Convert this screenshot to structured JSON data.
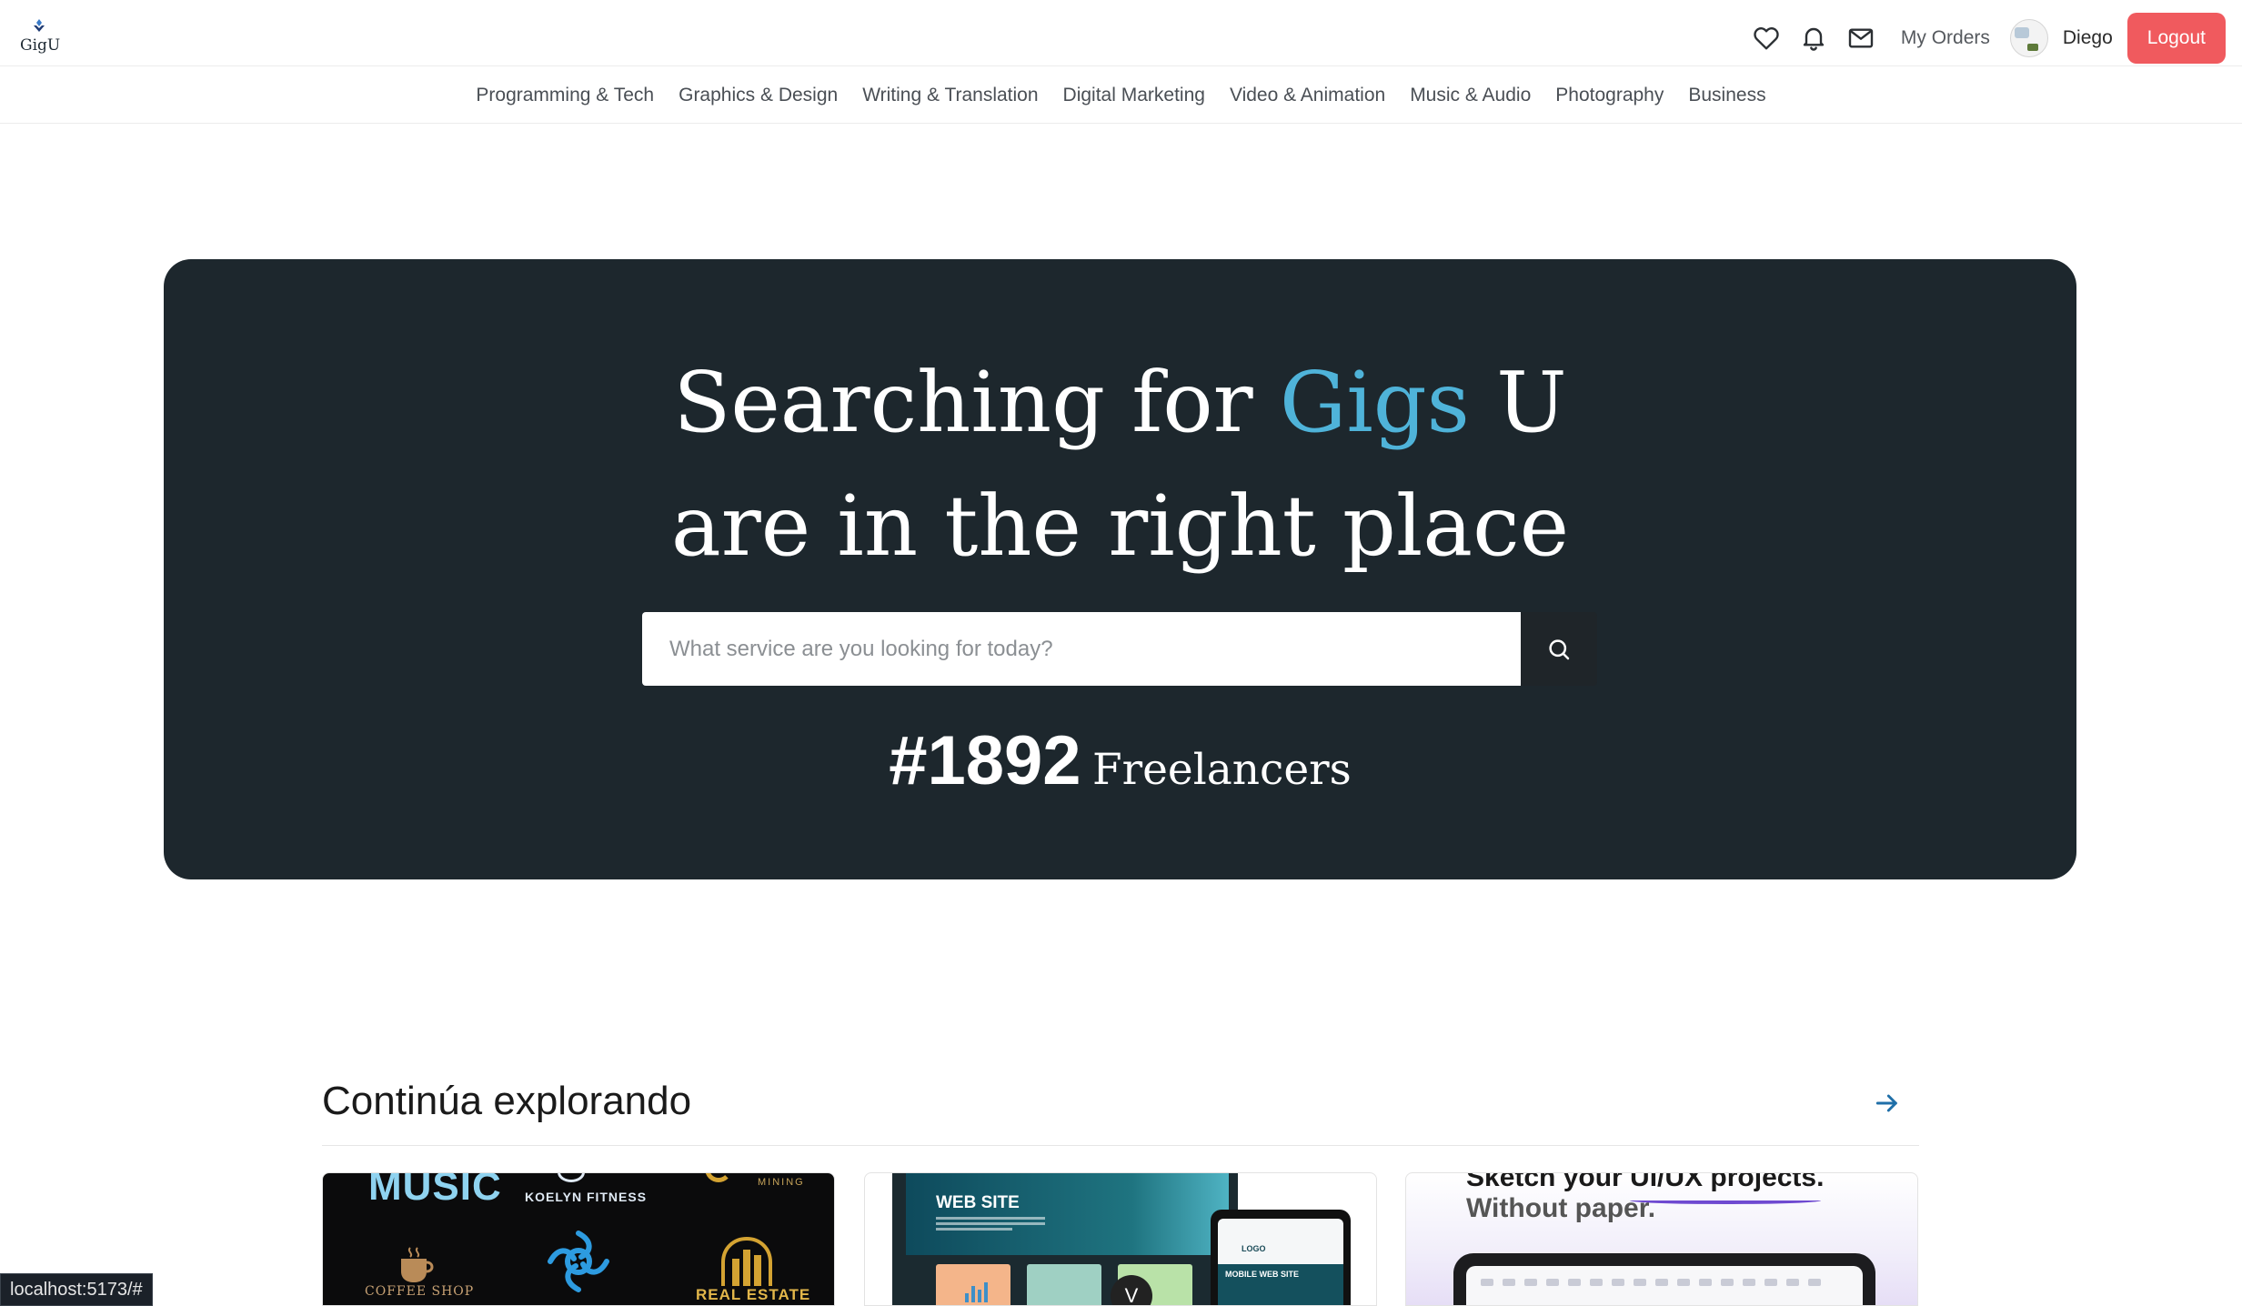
{
  "header": {
    "logo_text": "GigU",
    "my_orders_label": "My Orders",
    "username": "Diego",
    "logout_label": "Logout",
    "icons": [
      "heart-icon",
      "bell-icon",
      "mail-icon"
    ]
  },
  "categories": [
    {
      "label": "Programming & Tech"
    },
    {
      "label": "Graphics & Design"
    },
    {
      "label": "Writing & Translation"
    },
    {
      "label": "Digital Marketing"
    },
    {
      "label": "Video & Animation"
    },
    {
      "label": "Music & Audio"
    },
    {
      "label": "Photography"
    },
    {
      "label": "Business"
    }
  ],
  "hero": {
    "title_part1": "Searching for ",
    "title_accent": "Gigs",
    "title_part2": " U",
    "title_line2": "are in the right place",
    "search_placeholder": "What service are you looking for today?",
    "freelancer_count": "#1892",
    "freelancer_label": "Freelancers",
    "accent_color": "#4fb3d9",
    "background_color": "#1d272d"
  },
  "explore": {
    "title": "Continúa explorando",
    "cards": [
      {
        "texts": [
          "MUSIC",
          "KOELYN FITNESS",
          "MINING",
          "COFFEE SHOP",
          "REAL ESTATE"
        ]
      },
      {
        "texts": [
          "WEB SITE",
          "LOGO",
          "MOBILE WEB SITE",
          "V"
        ]
      },
      {
        "texts": [
          "Sketch your UI/UX projects.",
          "Without paper."
        ]
      }
    ]
  },
  "status": {
    "url": "localhost:5173/#"
  },
  "colors": {
    "logout_button": "#f05a5e",
    "arrow": "#1f6fa8"
  }
}
